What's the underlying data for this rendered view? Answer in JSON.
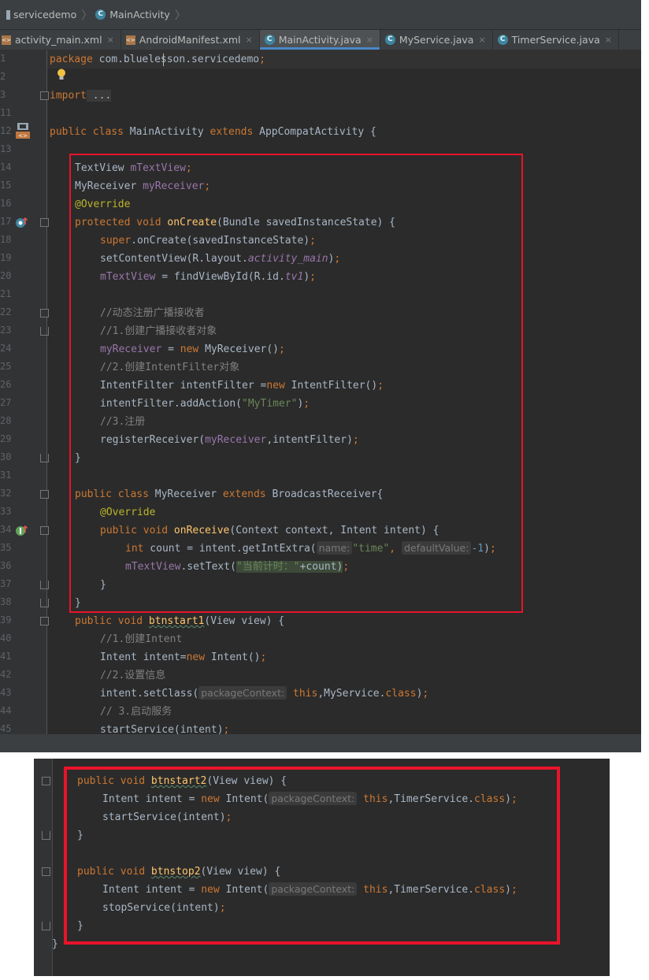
{
  "breadcrumbs": {
    "project": "servicedemo",
    "file": "MainActivity"
  },
  "tabs": [
    {
      "label": "activity_main.xml",
      "icon": "xml-file-icon",
      "active": false
    },
    {
      "label": "AndroidManifest.xml",
      "icon": "xml-file-icon",
      "active": false
    },
    {
      "label": "MainActivity.java",
      "icon": "class-icon",
      "active": true
    },
    {
      "label": "MyService.java",
      "icon": "class-icon",
      "active": false
    },
    {
      "label": "TimerService.java",
      "icon": "class-icon",
      "active": false
    }
  ],
  "tab_close_glyph": "×",
  "line_numbers": [
    "1",
    "2",
    "3",
    "11",
    "12",
    "13",
    "14",
    "15",
    "16",
    "17",
    "18",
    "19",
    "20",
    "21",
    "22",
    "23",
    "24",
    "25",
    "26",
    "27",
    "28",
    "29",
    "30",
    "31",
    "32",
    "33",
    "34",
    "35",
    "36",
    "37",
    "38",
    "39",
    "40",
    "41",
    "42",
    "43",
    "44",
    "45"
  ],
  "code": {
    "l1_kw": "package",
    "l1_rest": " com.bluelesson.servicedemo",
    "l1_semi": ";",
    "l3_kw": "import",
    "l3_rest": " ...",
    "l12_kw1": "public",
    "l12_kw2": "class",
    "l12_name": " MainActivity ",
    "l12_kw3": "extends",
    "l12_rest": " AppCompatActivity {",
    "l14_type": "TextView ",
    "l14_field": "mTextView",
    "l14_semi": ";",
    "l15_type": "MyReceiver ",
    "l15_field": "myReceiver",
    "l15_semi": ";",
    "l16_ann": "@Override",
    "l17_kw": "protected void ",
    "l17_fn": "onCreate",
    "l17_rest": "(Bundle savedInstanceState) {",
    "l18_kw": "super",
    "l18_rest": ".onCreate(savedInstanceState)",
    "l18_semi": ";",
    "l19_a": "setContentView(R.layout.",
    "l19_it": "activity_main",
    "l19_b": ")",
    "l19_semi": ";",
    "l20_field": "mTextView",
    "l20_a": " = findViewById(R.id.",
    "l20_it": "tv1",
    "l20_b": ")",
    "l20_semi": ";",
    "l22_cmt": "//动态注册广播接收者",
    "l23_cmt": "//1.创建广播接收者对象",
    "l24_field": "myReceiver",
    "l24_a": " = ",
    "l24_kw": "new",
    "l24_b": " MyReceiver()",
    "l24_semi": ";",
    "l25_cmt": "//2.创建IntentFilter对象",
    "l26_a": "IntentFilter intentFilter =",
    "l26_kw": "new",
    "l26_b": " IntentFilter()",
    "l26_semi": ";",
    "l27_a": "intentFilter.addAction(",
    "l27_str": "\"MyTimer\"",
    "l27_b": ")",
    "l27_semi": ";",
    "l28_cmt": "//3.注册",
    "l29_a": "registerReceiver(",
    "l29_field": "myReceiver",
    "l29_b": ",intentFilter)",
    "l29_semi": ";",
    "l30": "}",
    "l32_kw1": "public class",
    "l32_a": " MyReceiver ",
    "l32_kw2": "extends",
    "l32_b": " BroadcastReceiver{",
    "l33_ann": "@Override",
    "l34_kw": "public void ",
    "l34_fn": "onReceive",
    "l34_rest": "(Context context, Intent intent) {",
    "l35_kw": "int",
    "l35_a": " count = intent.getIntExtra(",
    "l35_hint1": "name:",
    "l35_str": "\"time\"",
    "l35_comma": ", ",
    "l35_hint2": "defaultValue:",
    "l35_num": "-1",
    "l35_b": ")",
    "l35_semi": ";",
    "l36_field": "mTextView",
    "l36_a": ".setText(",
    "l36_str": "\"当前计时：\"",
    "l36_b": "+count)",
    "l36_semi": ";",
    "l37": "}",
    "l38": "}",
    "l39_kw": "public void ",
    "l39_fn": "btnstart1",
    "l39_rest": "(View view) {",
    "l40_cmt": "//1.创建Intent",
    "l41_a": "Intent intent=",
    "l41_kw": "new",
    "l41_b": " Intent()",
    "l41_semi": ";",
    "l42_cmt": "//2.设置信息",
    "l43_a": "intent.setClass(",
    "l43_hint": "packageContext:",
    "l43_kw": "this",
    "l43_b": ",MyService.",
    "l43_kw2": "class",
    "l43_c": ")",
    "l43_semi": ";",
    "l44_cmt": "// 3.启动服务",
    "l45_a": "startService(intent)",
    "l45_semi": ";"
  },
  "code2": {
    "a_kw": "public void ",
    "a_fn": "btnstart2",
    "a_rest": "(View view) {",
    "b_a": "Intent intent = ",
    "b_kw": "new",
    "b_b": " Intent(",
    "b_hint": "packageContext:",
    "b_kw2": "this",
    "b_c": ",TimerService.",
    "b_kw3": "class",
    "b_d": ")",
    "b_semi": ";",
    "c_a": "startService(intent)",
    "c_semi": ";",
    "d": "}",
    "e_kw": "public void ",
    "e_fn": "btnstop2",
    "e_rest": "(View view) {",
    "f_a": "Intent intent = ",
    "f_kw": "new",
    "f_b": " Intent(",
    "f_hint": "packageContext:",
    "f_kw2": "this",
    "f_c": ",TimerService.",
    "f_kw3": "class",
    "f_d": ")",
    "f_semi": ";",
    "g_a": "stopService(intent)",
    "g_semi": ";",
    "h": "}",
    "i": "}"
  },
  "colors": {
    "background": "#2b2b2b",
    "keyword": "#cc7832",
    "function": "#ffc66d",
    "field": "#9876aa",
    "string": "#6a8759",
    "number": "#6897bb",
    "comment": "#808080",
    "annotation": "#bbb529",
    "highlight_box": "#e8142a",
    "active_tab_underline": "#4a88c7"
  }
}
